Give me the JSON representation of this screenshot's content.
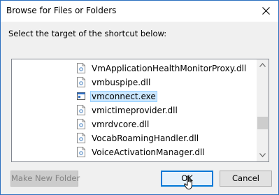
{
  "dialog": {
    "title": "Browse for Files or Folders",
    "prompt": "Select the target of the shortcut below:"
  },
  "tree": {
    "items": [
      {
        "label": "VmApplicationHealthMonitorProxy.dll",
        "icon": "dll-file-icon"
      },
      {
        "label": "vmbuspipe.dll",
        "icon": "dll-file-icon"
      },
      {
        "label": "vmconnect.exe",
        "icon": "exe-file-icon",
        "selected": true
      },
      {
        "label": "vmictimeprovider.dll",
        "icon": "dll-file-icon"
      },
      {
        "label": "vmrdvcore.dll",
        "icon": "dll-file-icon"
      },
      {
        "label": "VocabRoamingHandler.dll",
        "icon": "dll-file-icon"
      },
      {
        "label": "VoiceActivationManager.dll",
        "icon": "dll-file-icon"
      }
    ]
  },
  "buttons": {
    "make_new_folder": "Make New Folder",
    "ok": "OK",
    "cancel": "Cancel"
  },
  "colors": {
    "selection_bg": "#cce8ff",
    "accent": "#0078d7"
  }
}
